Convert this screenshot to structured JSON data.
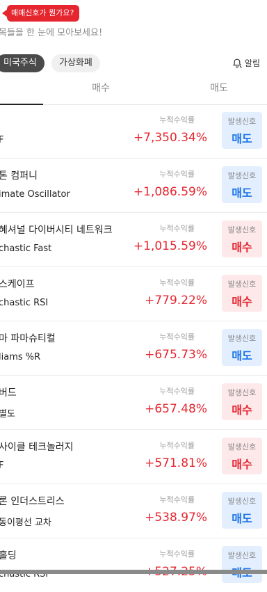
{
  "tooltip": {
    "text": "매매신호가 뭔가요?"
  },
  "subtitle": "목들을 한 눈에 모아보세요!",
  "chips": [
    {
      "label": "미국주식"
    },
    {
      "label": "가상화폐"
    }
  ],
  "alarm": {
    "label": "알림",
    "icon": "bell-icon"
  },
  "tabs": [
    {
      "label": "매수"
    },
    {
      "label": "매도"
    }
  ],
  "cumulative_label": "누적수익률",
  "signal_label": "발생신호",
  "colors": {
    "red": "#e5262f",
    "blue": "#1a73e8",
    "sell_bg": "#e3efff",
    "buy_bg": "#fde8ea"
  },
  "items": [
    {
      "name": "",
      "strategy": "F",
      "return": "+7,350.34%",
      "signal": "매도",
      "type": "sell"
    },
    {
      "name": "톤 컴퍼니",
      "strategy": "imate Oscillator",
      "return": "+1,086.59%",
      "signal": "매도",
      "type": "sell"
    },
    {
      "name": "혜셔널 다이버시티 네트워크",
      "strategy": "chastic Fast",
      "return": "+1,015.59%",
      "signal": "매수",
      "type": "buy"
    },
    {
      "name": "스케이프",
      "strategy": "chastic RSI",
      "return": "+779.22%",
      "signal": "매수",
      "type": "buy"
    },
    {
      "name": "마 파마슈티컬",
      "strategy": "liams %R",
      "return": "+675.73%",
      "signal": "매도",
      "type": "sell"
    },
    {
      "name": "버드",
      "strategy": "별도",
      "return": "+657.48%",
      "signal": "매수",
      "type": "buy"
    },
    {
      "name": "사이클 테크놀러지",
      "strategy": "F",
      "return": "+571.81%",
      "signal": "매수",
      "type": "buy"
    },
    {
      "name": "론 인더스트리스",
      "strategy": "동이평선 교차",
      "return": "+538.97%",
      "signal": "매도",
      "type": "sell"
    },
    {
      "name": "홀딩",
      "strategy": "chastic RSI",
      "return": "+527.25%",
      "signal": "매도",
      "type": "sell"
    }
  ]
}
